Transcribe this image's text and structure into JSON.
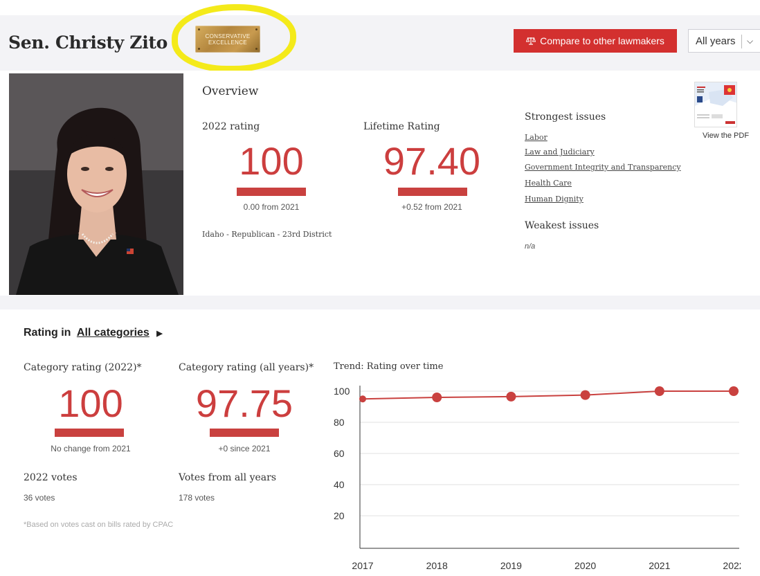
{
  "header": {
    "name": "Sen. Christy Zito",
    "badge_line1": "CONSERVATIVE",
    "badge_line2": "EXCELLENCE",
    "compare_label": "Compare to other lawmakers",
    "years_select": "All years"
  },
  "overview": {
    "title": "Overview",
    "current_label": "2022 rating",
    "current_value": "100",
    "current_change": "0.00 from 2021",
    "lifetime_label": "Lifetime Rating",
    "lifetime_value": "97.40",
    "lifetime_change": "+0.52 from 2021",
    "district": "Idaho - Republican - 23rd District"
  },
  "issues": {
    "strongest_title": "Strongest issues",
    "strongest": [
      "Labor",
      "Law and Judiciary",
      "Government Integrity and Transparency",
      "Health Care",
      "Human Dignity"
    ],
    "weakest_title": "Weakest issues",
    "weakest_value": "n/a"
  },
  "pdf": {
    "link": "View the PDF"
  },
  "category": {
    "heading_prefix": "Rating in",
    "heading_link": "All categories",
    "cat_2022_label": "Category rating (2022)*",
    "cat_2022_value": "100",
    "cat_2022_change": "No change from 2021",
    "cat_all_label": "Category rating (all years)*",
    "cat_all_value": "97.75",
    "cat_all_change": "+0 since 2021",
    "votes_2022_label": "2022 votes",
    "votes_2022_value": "36 votes",
    "votes_all_label": "Votes from all years",
    "votes_all_value": "178 votes",
    "footnote": "*Based on votes cast on bills rated by CPAC",
    "trend_title": "Trend: Rating over time"
  },
  "colors": {
    "accent": "#d3302f",
    "number": "#cc3e3e",
    "badge_gold": "#b3863e",
    "highlight": "#f4ea1a"
  },
  "chart_data": {
    "type": "line",
    "title": "Trend: Rating over time",
    "x": [
      "2017",
      "2018",
      "2019",
      "2020",
      "2021",
      "2022"
    ],
    "series": [
      {
        "values": [
          95,
          96,
          96.5,
          97.5,
          100,
          100
        ]
      }
    ],
    "ylim": [
      0,
      100
    ],
    "yticks": [
      20,
      40,
      60,
      80,
      100
    ],
    "grid": true
  }
}
